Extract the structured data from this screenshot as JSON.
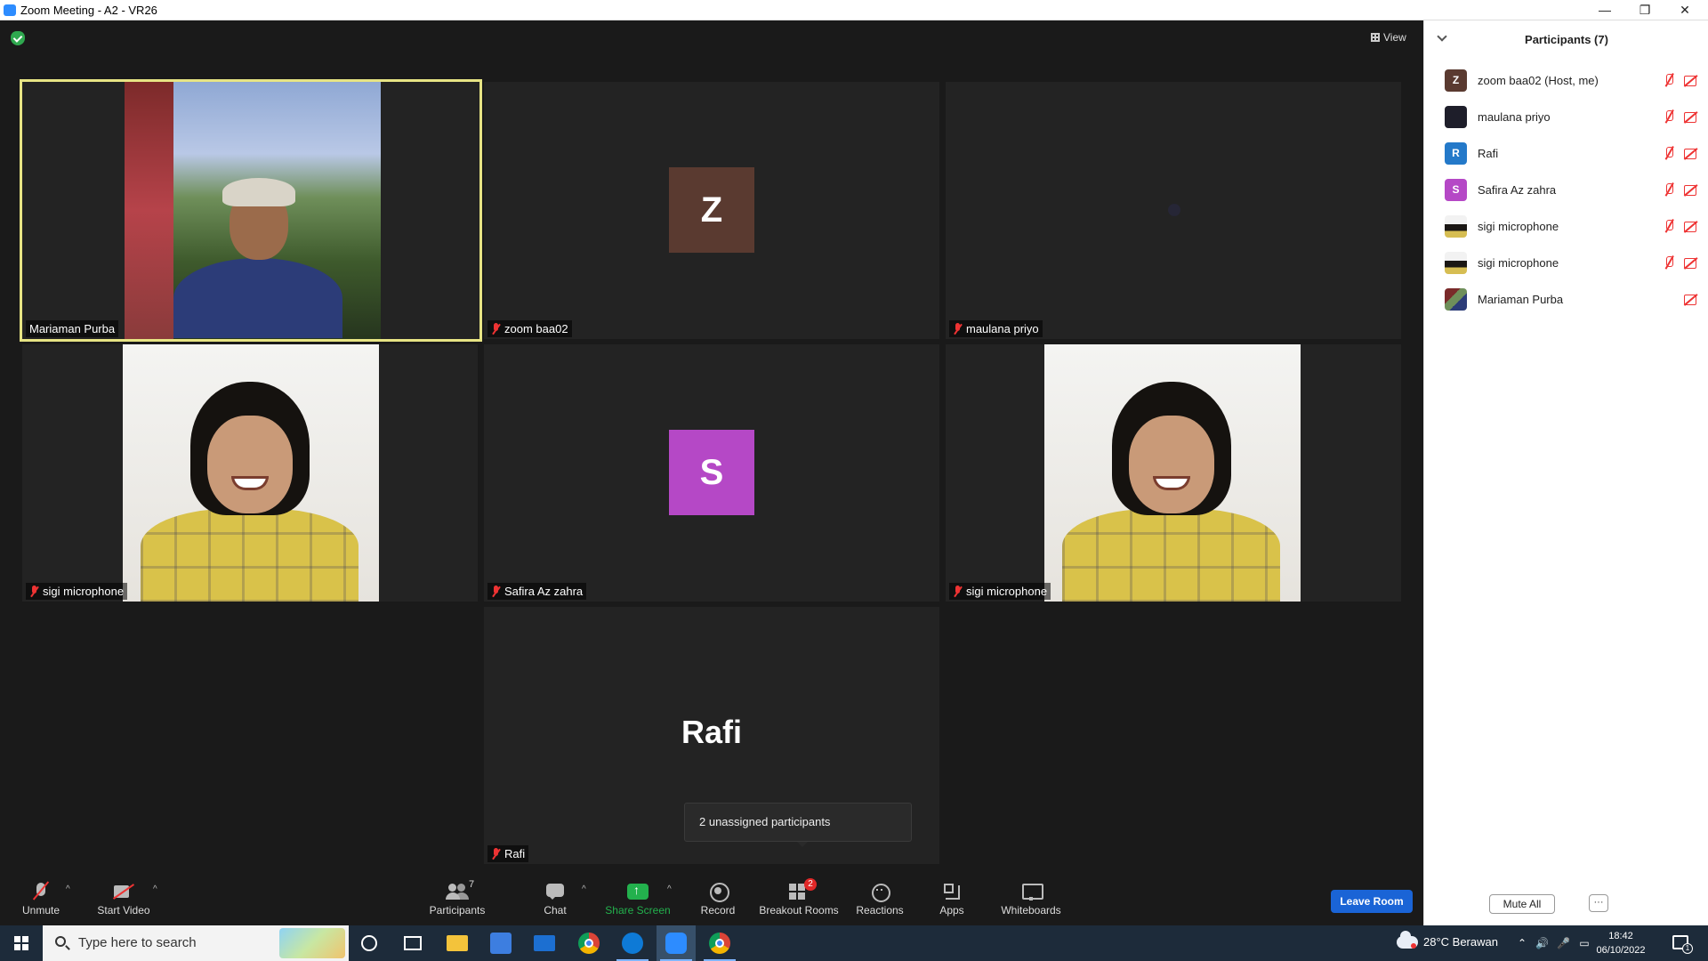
{
  "window": {
    "title": "Zoom Meeting - A2 - VR26",
    "minimize": "—",
    "restore": "❐",
    "close": "✕"
  },
  "view_button": {
    "label": "View"
  },
  "tiles": [
    {
      "name": "Mariaman Purba",
      "muted": false,
      "kind": "video-man",
      "active": true
    },
    {
      "name": "zoom baa02",
      "muted": true,
      "kind": "initial",
      "initial": "Z",
      "color": "#5a3a30"
    },
    {
      "name": "maulana priyo",
      "muted": true,
      "kind": "empty"
    },
    {
      "name": "sigi microphone",
      "muted": true,
      "kind": "video-girl"
    },
    {
      "name": "Safira Az zahra",
      "muted": true,
      "kind": "initial",
      "initial": "S",
      "color": "#b548c6"
    },
    {
      "name": "sigi microphone",
      "muted": true,
      "kind": "video-girl"
    },
    {
      "name": "Rafi",
      "muted": true,
      "kind": "bigname",
      "bigname": "Rafi"
    }
  ],
  "tooltip": {
    "text": "2 unassigned participants"
  },
  "toolbar": {
    "unmute": "Unmute",
    "start_video": "Start Video",
    "participants": "Participants",
    "participants_count": "7",
    "chat": "Chat",
    "share_screen": "Share Screen",
    "record": "Record",
    "breakout_rooms": "Breakout Rooms",
    "breakout_badge": "2",
    "reactions": "Reactions",
    "apps": "Apps",
    "whiteboards": "Whiteboards",
    "caret": "^",
    "leave": "Leave Room"
  },
  "colors": {
    "share_green": "#23b14d",
    "leave_blue": "#1a64d6",
    "active_border": "#e7e484",
    "muted_red": "#e33333"
  },
  "panel": {
    "title": "Participants (7)",
    "mute_all": "Mute All",
    "more": "···",
    "participants": [
      {
        "name": "zoom baa02 (Host, me)",
        "initial": "Z",
        "color": "#5a3a30",
        "mic_muted": true,
        "cam_off": true
      },
      {
        "name": "maulana priyo",
        "initial": "",
        "color": "#1e1e2a",
        "mic_muted": true,
        "cam_off": true
      },
      {
        "name": "Rafi",
        "initial": "R",
        "color": "#2479c9",
        "mic_muted": true,
        "cam_off": true
      },
      {
        "name": "Safira Az zahra",
        "initial": "S",
        "color": "#b548c6",
        "mic_muted": true,
        "cam_off": true
      },
      {
        "name": "sigi microphone",
        "initial": "",
        "avatar": "photo",
        "mic_muted": true,
        "cam_off": true
      },
      {
        "name": "sigi microphone",
        "initial": "",
        "avatar": "photo",
        "mic_muted": true,
        "cam_off": true
      },
      {
        "name": "Mariaman Purba",
        "initial": "",
        "avatar": "photo2",
        "mic_muted": false,
        "cam_off": true
      }
    ]
  },
  "taskbar": {
    "search_placeholder": "Type here to search",
    "weather": "28°C  Berawan",
    "time": "18:42",
    "date": "06/10/2022",
    "notifications": "1"
  }
}
